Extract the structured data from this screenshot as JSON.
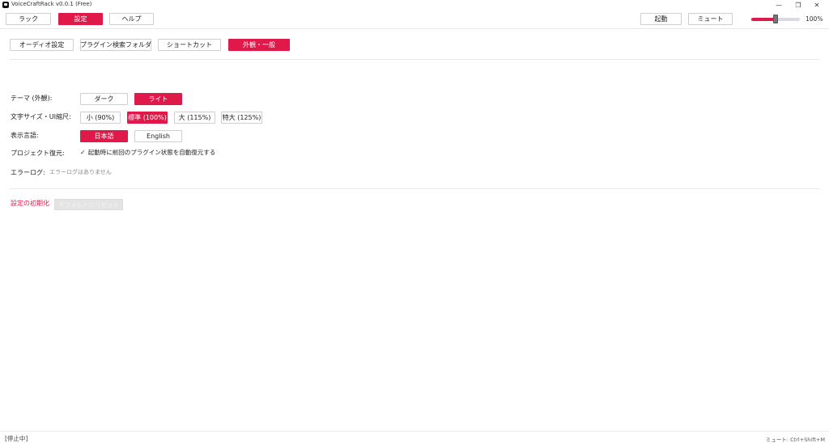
{
  "window": {
    "title": "VoiceCraftRack v0.0.1 (Free)",
    "minimize_glyph": "—",
    "maximize_glyph": "❐",
    "close_glyph": "✕"
  },
  "topbar": {
    "tabs": [
      {
        "label": "ラック",
        "active": false
      },
      {
        "label": "設定",
        "active": true
      },
      {
        "label": "ヘルプ",
        "active": false
      }
    ],
    "start_label": "起動",
    "mute_label": "ミュート",
    "volume_percent": 100,
    "volume_label": "100%",
    "volume_fill_fraction": 0.5
  },
  "settings_tabs": [
    {
      "label": "オーディオ設定",
      "active": false
    },
    {
      "label": "プラグイン検索フォルダ",
      "active": false
    },
    {
      "label": "ショートカット",
      "active": false
    },
    {
      "label": "外観・一般",
      "active": true
    }
  ],
  "appearance": {
    "theme_label": "テーマ (外観):",
    "theme_options": [
      {
        "label": "ダーク",
        "active": false
      },
      {
        "label": "ライト",
        "active": true
      }
    ],
    "font_size_label": "文字サイズ・UI縮尺:",
    "font_size_options": [
      {
        "label": "小 (90%)",
        "active": false
      },
      {
        "label": "標準 (100%)",
        "active": true
      },
      {
        "label": "大 (115%)",
        "active": false
      },
      {
        "label": "特大 (125%)",
        "active": false
      }
    ],
    "language_label": "表示言語:",
    "language_options": [
      {
        "label": "日本語",
        "active": true
      },
      {
        "label": "English",
        "active": false
      }
    ],
    "project_restore_label": "プロジェクト復元:",
    "project_restore_checkbox": "起動時に前回のプラグイン状態を自動復元する",
    "project_restore_checked": true,
    "error_log_label": "エラーログ:",
    "error_log_value": "エラーログはありません"
  },
  "reset": {
    "label": "設定の初期化",
    "button_label": "デフォルトにリセット"
  },
  "status": {
    "left": "[停止中]",
    "right": "ミュート: Ctrl+Shift+M"
  },
  "colors": {
    "accent": "#e0194b"
  }
}
